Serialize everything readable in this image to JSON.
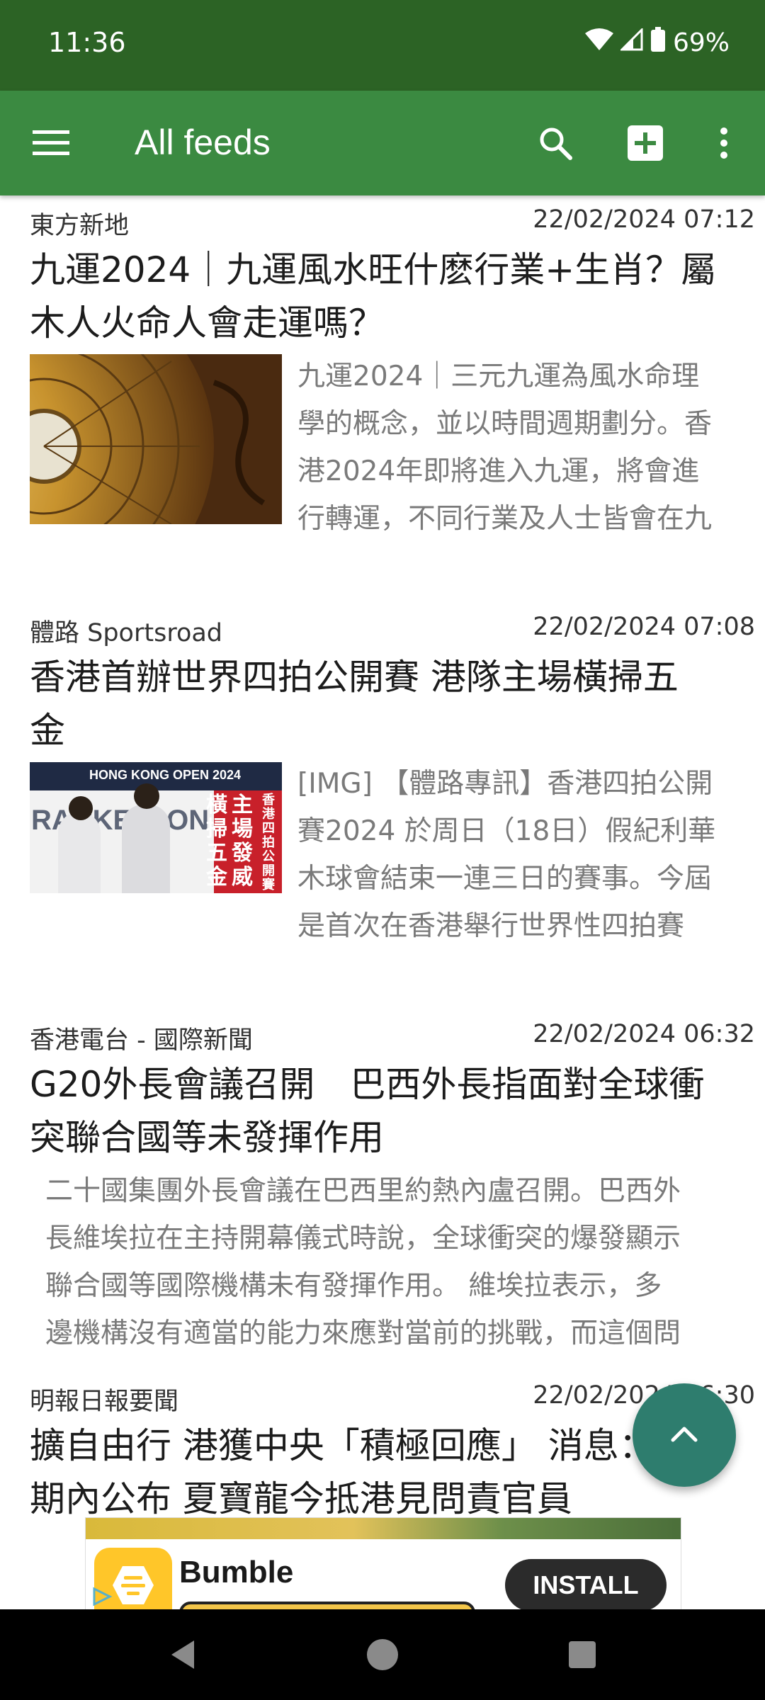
{
  "status_bar": {
    "time": "11:36",
    "battery": "69%"
  },
  "toolbar": {
    "title": "All feeds"
  },
  "feed": [
    {
      "source": "東方新地",
      "date": "22/02/2024 07:12",
      "title_lines": [
        "九運2024｜九運風水旺什麽行業+生肖？屬",
        "木人火命人會走運嗎？"
      ],
      "snippet_lines": [
        "九運2024｜三元九運為風水命理",
        "學的概念，並以時間週期劃分。香",
        "港2024年即將進入九運，將會進",
        "行轉運，不同行業及人士皆會在九"
      ],
      "thumb": "compass-image"
    },
    {
      "source": "體路 Sportsroad",
      "date": "22/02/2024 07:08",
      "title_lines": [
        "香港首辦世界四拍公開賽 港隊主場橫掃五",
        "金"
      ],
      "snippet_lines": [
        "[IMG] 【體路專訊】香港四拍公開",
        "賽2024 於周日（18日）假紀利華",
        "木球會結束一連三日的賽事。今屆",
        "是首次在香港舉行世界性四拍賽"
      ],
      "thumb": "sports-image",
      "thumb_text": {
        "banner": "HONG KONG OPEN 2024",
        "rac": "RACKETLON",
        "col1": "主場發威",
        "col2": "橫掃五金",
        "col3": "香港四拍公開賽"
      }
    },
    {
      "source": "香港電台 - 國際新聞",
      "date": "22/02/2024 06:32",
      "title_lines": [
        "G20外長會議召開　巴西外長指面對全球衝",
        "突聯合國等未發揮作用"
      ],
      "snippet_lines": [
        "二十國集團外長會議在巴西里約熱內盧召開。巴西外",
        "長維埃拉在主持開幕儀式時說，全球衝突的爆發顯示",
        "聯合國等國際機構未有發揮作用。 維埃拉表示，多",
        "邊機構沒有適當的能力來應對當前的挑戰，而這個問"
      ]
    },
    {
      "source": "明報日報要聞",
      "date": "22/02/2024 06:30",
      "title_lines": [
        "擴自由行 港獲中央「積極回應」 消息：短",
        "期內公布 夏寶龍今抵港見問責官員"
      ]
    }
  ],
  "ad": {
    "name": "Bumble",
    "install_label": "INSTALL"
  },
  "colors": {
    "statusbar": "#2c6325",
    "toolbar": "#3b8a41",
    "fab": "#2e7d6e"
  }
}
